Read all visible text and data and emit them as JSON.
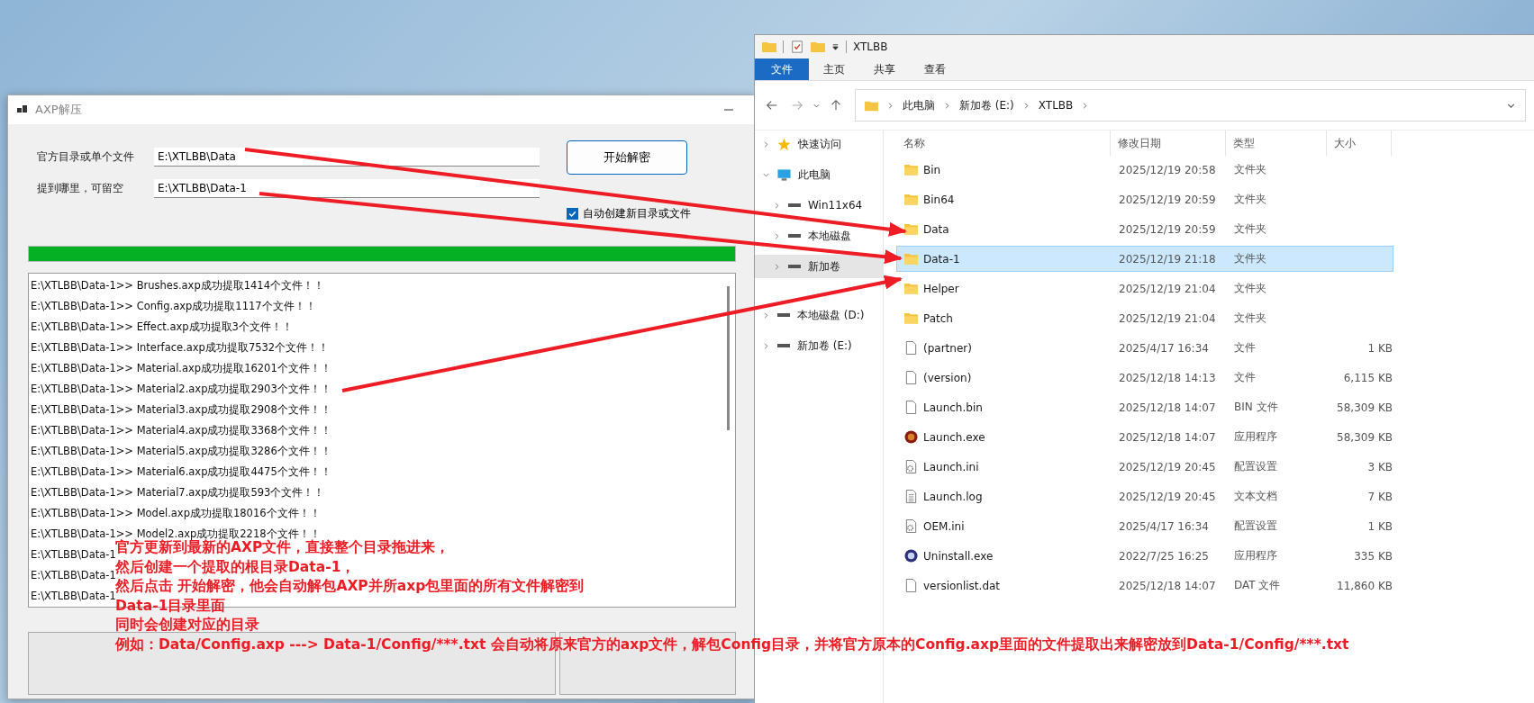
{
  "axp_window": {
    "title": "AXP解压",
    "source_label": "官方目录或单个文件",
    "source_value": "E:\\XTLBB\\Data",
    "target_label": "提到哪里，可留空",
    "target_value": "E:\\XTLBB\\Data-1",
    "start_button": "开始解密",
    "auto_create": {
      "label": "自动创建新目录或文件",
      "checked": true
    },
    "progress": {
      "level": 1
    },
    "log": [
      "E:\\XTLBB\\Data-1>> Brushes.axp成功提取1414个文件！！",
      "E:\\XTLBB\\Data-1>> Config.axp成功提取1117个文件！！",
      "E:\\XTLBB\\Data-1>> Effect.axp成功提取3个文件！！",
      "E:\\XTLBB\\Data-1>> Interface.axp成功提取7532个文件！！",
      "E:\\XTLBB\\Data-1>> Material.axp成功提取16201个文件！！",
      "E:\\XTLBB\\Data-1>> Material2.axp成功提取2903个文件！！",
      "E:\\XTLBB\\Data-1>> Material3.axp成功提取2908个文件！！",
      "E:\\XTLBB\\Data-1>> Material4.axp成功提取3368个文件！！",
      "E:\\XTLBB\\Data-1>> Material5.axp成功提取3286个文件！！",
      "E:\\XTLBB\\Data-1>> Material6.axp成功提取4475个文件！！",
      "E:\\XTLBB\\Data-1>> Material7.axp成功提取593个文件！！",
      "E:\\XTLBB\\Data-1>> Model.axp成功提取18016个文件！！",
      "E:\\XTLBB\\Data-1>> Model2.axp成功提取2218个文件！！",
      "E:\\XTLBB\\Data-1",
      "E:\\XTLBB\\Data-1",
      "E:\\XTLBB\\Data-1"
    ]
  },
  "explorer": {
    "title": "XTLBB",
    "ribbon_tabs": [
      {
        "label": "文件",
        "selected": true
      },
      {
        "label": "主页",
        "selected": false
      },
      {
        "label": "共享",
        "selected": false
      },
      {
        "label": "查看",
        "selected": false
      }
    ],
    "breadcrumb": [
      "此电脑",
      "新加卷 (E:)",
      "XTLBB"
    ],
    "sidebar": [
      {
        "label": "快速访问",
        "kind": "star",
        "expanded": false,
        "selected": false
      },
      {
        "label": "此电脑",
        "kind": "pc",
        "expanded": true,
        "selected": false,
        "children": [
          {
            "label": "Win11x64",
            "kind": "drive",
            "expanded": false,
            "selected": false
          },
          {
            "label": "本地磁盘",
            "kind": "drive",
            "expanded": false,
            "selected": false
          },
          {
            "label": "新加卷",
            "kind": "drive",
            "expanded": false,
            "selected": true
          }
        ]
      },
      {
        "label": "本地磁盘 (D:)",
        "kind": "drive",
        "expanded": false,
        "selected": false
      },
      {
        "label": "新加卷 (E:)",
        "kind": "drive",
        "expanded": false,
        "selected": false
      }
    ],
    "columns": [
      "名称",
      "修改日期",
      "类型",
      "大小"
    ],
    "files": [
      {
        "name": "Bin",
        "date": "2025/12/19 20:58",
        "type": "文件夹",
        "kind": "folder",
        "selected": false
      },
      {
        "name": "Bin64",
        "date": "2025/12/19 20:59",
        "type": "文件夹",
        "kind": "folder",
        "selected": false
      },
      {
        "name": "Data",
        "date": "2025/12/19 20:59",
        "type": "文件夹",
        "kind": "folder",
        "selected": false
      },
      {
        "name": "Data-1",
        "date": "2025/12/19 21:18",
        "type": "文件夹",
        "kind": "folder",
        "selected": true
      },
      {
        "name": "Helper",
        "date": "2025/12/19 21:04",
        "type": "文件夹",
        "kind": "folder",
        "selected": false
      },
      {
        "name": "Patch",
        "date": "2025/12/19 21:04",
        "type": "文件夹",
        "kind": "folder",
        "selected": false
      },
      {
        "name": "(partner)",
        "date": "2025/4/17 16:34",
        "type": "文件",
        "size": "1 KB",
        "kind": "file",
        "selected": false
      },
      {
        "name": "(version)",
        "date": "2025/12/18 14:13",
        "type": "文件",
        "size": "6,115 KB",
        "kind": "file",
        "selected": false
      },
      {
        "name": "Launch.bin",
        "date": "2025/12/18 14:07",
        "type": "BIN 文件",
        "size": "58,309 KB",
        "kind": "file",
        "selected": false
      },
      {
        "name": "Launch.exe",
        "date": "2025/12/18 14:07",
        "type": "应用程序",
        "size": "58,309 KB",
        "kind": "app-red",
        "selected": false
      },
      {
        "name": "Launch.ini",
        "date": "2025/12/19 20:45",
        "type": "配置设置",
        "size": "3 KB",
        "kind": "config",
        "selected": false
      },
      {
        "name": "Launch.log",
        "date": "2025/12/19 20:45",
        "type": "文本文档",
        "size": "7 KB",
        "kind": "text",
        "selected": false
      },
      {
        "name": "OEM.ini",
        "date": "2025/4/17 16:34",
        "type": "配置设置",
        "size": "1 KB",
        "kind": "config",
        "selected": false
      },
      {
        "name": "Uninstall.exe",
        "date": "2022/7/25 16:25",
        "type": "应用程序",
        "size": "335 KB",
        "kind": "app-blue",
        "selected": false
      },
      {
        "name": "versionlist.dat",
        "date": "2025/12/18 14:07",
        "type": "DAT 文件",
        "size": "11,860 KB",
        "kind": "file",
        "selected": false
      }
    ]
  },
  "annotation": {
    "lines": [
      "官方更新到最新的AXP文件，直接整个目录拖进来，",
      "然后创建一个提取的根目录Data-1，",
      "然后点击 开始解密，他会自动解包AXP并所axp包里面的所有文件解密到",
      "Data-1目录里面",
      "同时会创建对应的目录",
      "例如：Data/Config.axp ---> Data-1/Config/***.txt 会自动将原来官方的axp文件，解包Config目录，并将官方原本的Config.axp里面的文件提取出来解密放到Data-1/Config/***.txt"
    ]
  }
}
